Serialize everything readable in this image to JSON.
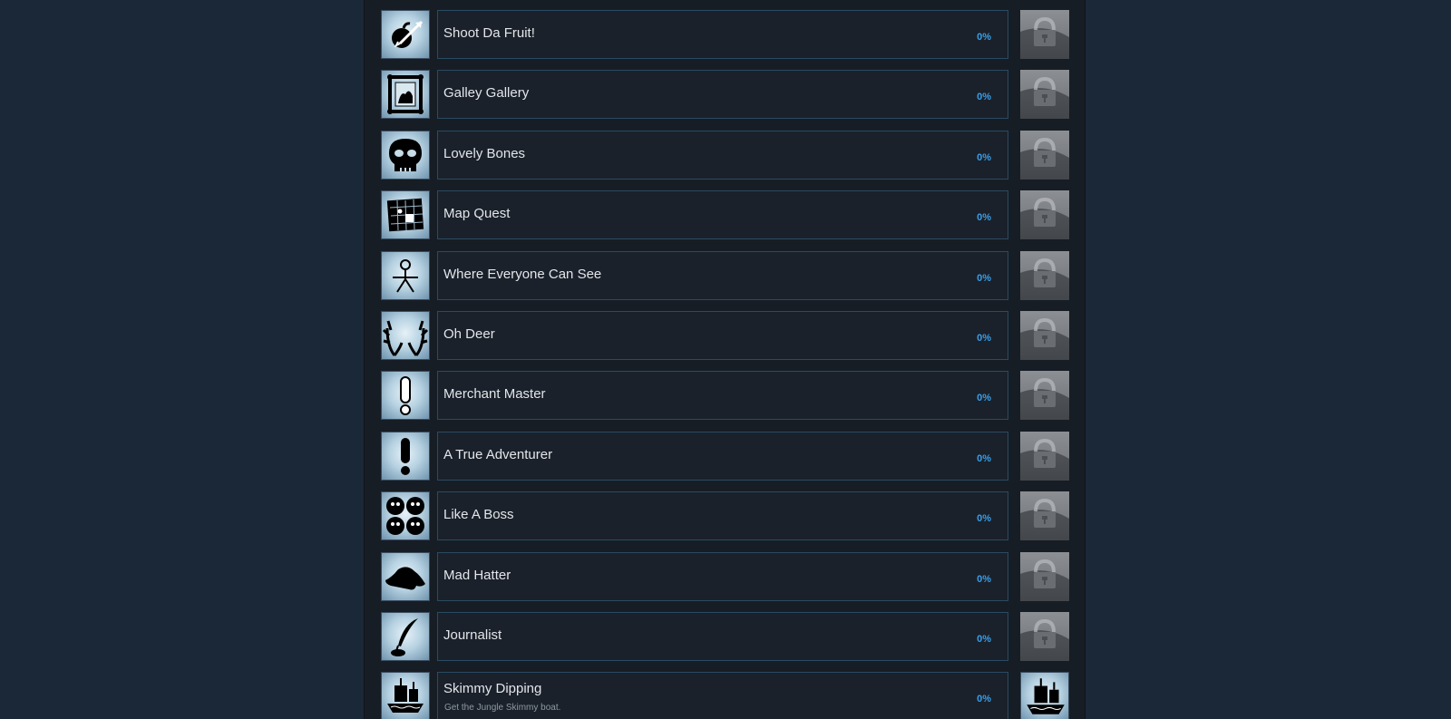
{
  "achievements": [
    {
      "name": "Shoot Da Fruit!",
      "description": "",
      "percent": "0%",
      "icon": "fruit-arrow-icon",
      "unlocked": false
    },
    {
      "name": "Galley Gallery",
      "description": "",
      "percent": "0%",
      "icon": "picture-frame-icon",
      "unlocked": false
    },
    {
      "name": "Lovely Bones",
      "description": "",
      "percent": "0%",
      "icon": "skull-icon",
      "unlocked": false
    },
    {
      "name": "Map Quest",
      "description": "",
      "percent": "0%",
      "icon": "map-icon",
      "unlocked": false
    },
    {
      "name": "Where Everyone Can See",
      "description": "",
      "percent": "0%",
      "icon": "scarecrow-icon",
      "unlocked": false
    },
    {
      "name": "Oh Deer",
      "description": "",
      "percent": "0%",
      "icon": "antlers-icon",
      "unlocked": false
    },
    {
      "name": "Merchant Master",
      "description": "",
      "percent": "0%",
      "icon": "exclamation-white-icon",
      "unlocked": false
    },
    {
      "name": "A True Adventurer",
      "description": "",
      "percent": "0%",
      "icon": "exclamation-black-icon",
      "unlocked": false
    },
    {
      "name": "Like A Boss",
      "description": "",
      "percent": "0%",
      "icon": "four-bosses-icon",
      "unlocked": false
    },
    {
      "name": "Mad Hatter",
      "description": "",
      "percent": "0%",
      "icon": "hat-icon",
      "unlocked": false
    },
    {
      "name": "Journalist",
      "description": "",
      "percent": "0%",
      "icon": "quill-ink-icon",
      "unlocked": false
    },
    {
      "name": "Skimmy Dipping",
      "description": "Get the Jungle Skimmy boat.",
      "percent": "0%",
      "icon": "boat-icon",
      "unlocked": true
    }
  ],
  "colors": {
    "page_bg": "#1b2838",
    "panel_bg": "#171d25",
    "row_border": "#2a4a62",
    "percent": "#3a9ee6",
    "name": "#e3e6e9"
  },
  "lock_icon": "padlock-icon"
}
